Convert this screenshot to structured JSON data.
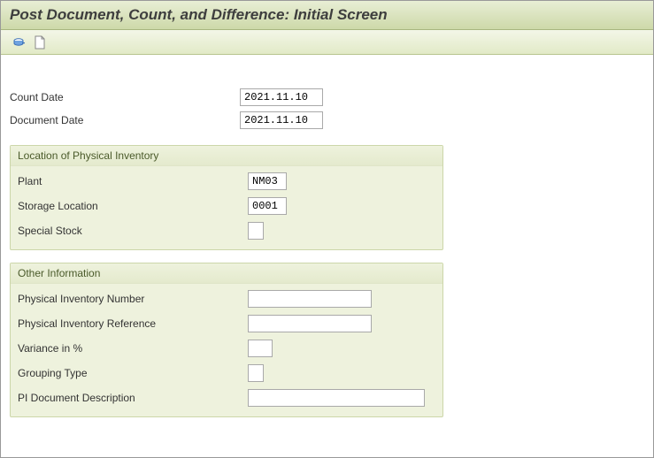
{
  "header": {
    "title": "Post Document, Count, and Difference: Initial Screen"
  },
  "toolbar": {
    "icons": [
      "run-icon",
      "new-doc-icon"
    ]
  },
  "top": {
    "count_date_label": "Count Date",
    "count_date_value": "2021.11.10",
    "doc_date_label": "Document Date",
    "doc_date_value": "2021.11.10"
  },
  "location": {
    "title": "Location of Physical Inventory",
    "plant_label": "Plant",
    "plant_value": "NM03",
    "sloc_label": "Storage Location",
    "sloc_value": "0001",
    "special_stock_label": "Special Stock",
    "special_stock_value": ""
  },
  "other": {
    "title": "Other Information",
    "pi_number_label": "Physical Inventory Number",
    "pi_number_value": "",
    "pi_ref_label": "Physical Inventory Reference",
    "pi_ref_value": "",
    "variance_label": "Variance in %",
    "variance_value": "",
    "grouping_label": "Grouping Type",
    "grouping_value": "",
    "desc_label": "PI Document Description",
    "desc_value": ""
  }
}
